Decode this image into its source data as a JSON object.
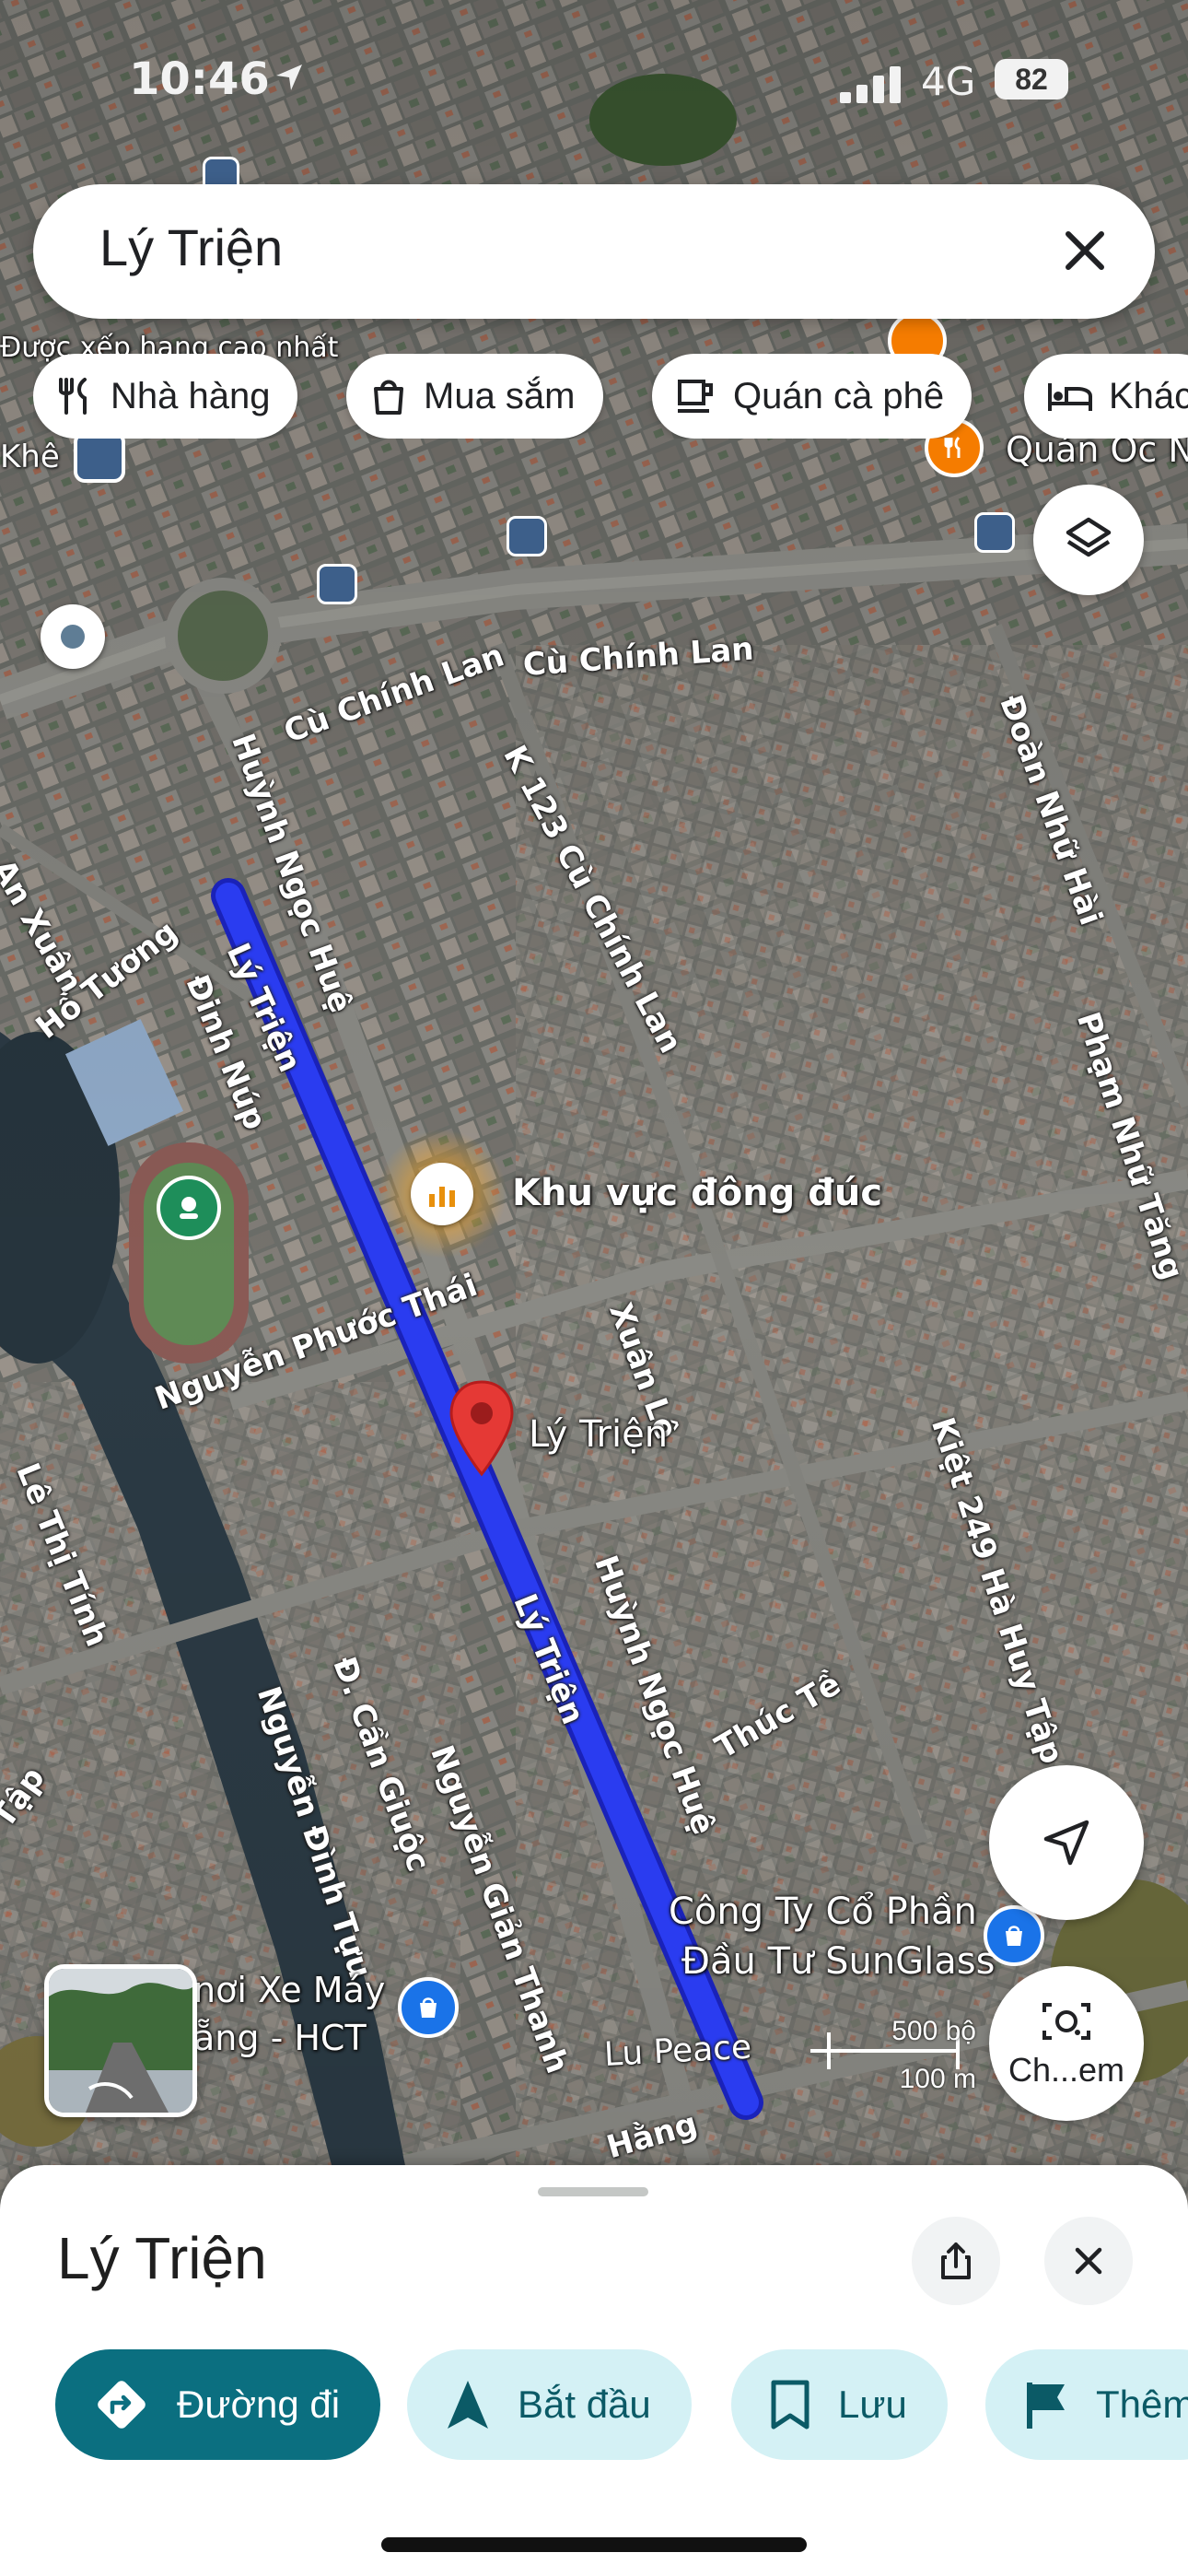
{
  "status_bar": {
    "time": "10:46",
    "network": "4G",
    "battery": "82"
  },
  "search": {
    "query": "Lý Triện"
  },
  "chips": [
    {
      "label": "Nhà hàng",
      "icon": "restaurant-icon"
    },
    {
      "label": "Mua sắm",
      "icon": "shopping-bag-icon"
    },
    {
      "label": "Quán cà phê",
      "icon": "coffee-icon"
    },
    {
      "label": "Khác",
      "icon": "hotel-icon"
    }
  ],
  "map": {
    "road_labels": [
      "Cù Chính Lan",
      "Cù Chính Lan",
      "K 123 Cù Chính Lan",
      "Đoàn Nhữ Hài",
      "Huỳnh Ngọc Huệ",
      "An Xuân",
      "Hồ Tương",
      "Lý Triện",
      "Đinh Núp",
      "Phạm Nhữ Tăng",
      "Nguyễn Phước Thái",
      "Xuân Lê",
      "Kiệt 249 Hà Huy Tập",
      "Lê Thị Tính",
      "Lý Triện",
      "Huỳnh Ngọc Huệ",
      "Thúc Tề",
      "Nguyễn Đình Tựu",
      "Đ. Cần Giuộc",
      "Nguyễn Giản Thanh",
      "Lu Peace",
      "Hằng",
      "Tập",
      "Khê"
    ],
    "poi_labels": [
      "Khu vực đông đúc",
      "Lý Triện",
      "Công Ty Cổ Phần",
      "Đầu Tư SunGlass",
      "Quán Ốc N",
      "nơi Xe Máy",
      "ẵng - HCT",
      "Được xếp hạng cao nhất"
    ],
    "crowded_area_label": "Khu vực đông đúc",
    "pin_label": "Lý Triện",
    "route_color": "#2a3cf0",
    "pin_color": "#e53935",
    "scale": {
      "top": "500 bộ",
      "bottom": "100 m"
    }
  },
  "map_buttons": {
    "layers": "layers-icon",
    "location": "navigation-arrow-icon",
    "lens_label": "Ch...em"
  },
  "sheet": {
    "title": "Lý Triện",
    "actions": [
      {
        "label": "Đường đi",
        "icon": "directions-icon",
        "style": "primary"
      },
      {
        "label": "Bắt đầu",
        "icon": "navigation-icon",
        "style": "secondary"
      },
      {
        "label": "Lưu",
        "icon": "bookmark-icon",
        "style": "secondary"
      },
      {
        "label": "Thêm",
        "icon": "flag-icon",
        "style": "secondary"
      }
    ]
  },
  "colors": {
    "primary": "#0b6f80",
    "secondary": "#d4f1f5"
  }
}
